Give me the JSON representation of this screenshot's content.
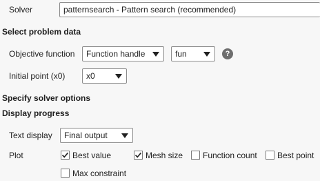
{
  "solver": {
    "label": "Solver",
    "value": "patternsearch - Pattern search (recommended)"
  },
  "problem_data": {
    "heading": "Select problem data",
    "objective_function": {
      "label": "Objective function",
      "type_value": "Function handle",
      "handle_value": "fun",
      "help": "?"
    },
    "initial_point": {
      "label": "Initial point (x0)",
      "value": "x0"
    }
  },
  "solver_options": {
    "heading": "Specify solver options"
  },
  "display_progress": {
    "heading": "Display progress",
    "text_display": {
      "label": "Text display",
      "value": "Final output"
    },
    "plot": {
      "label": "Plot",
      "options": [
        {
          "label": "Best value",
          "checked": true
        },
        {
          "label": "Mesh size",
          "checked": true
        },
        {
          "label": "Function count",
          "checked": false
        },
        {
          "label": "Best point",
          "checked": false
        },
        {
          "label": "Max constraint",
          "checked": false
        }
      ]
    }
  }
}
